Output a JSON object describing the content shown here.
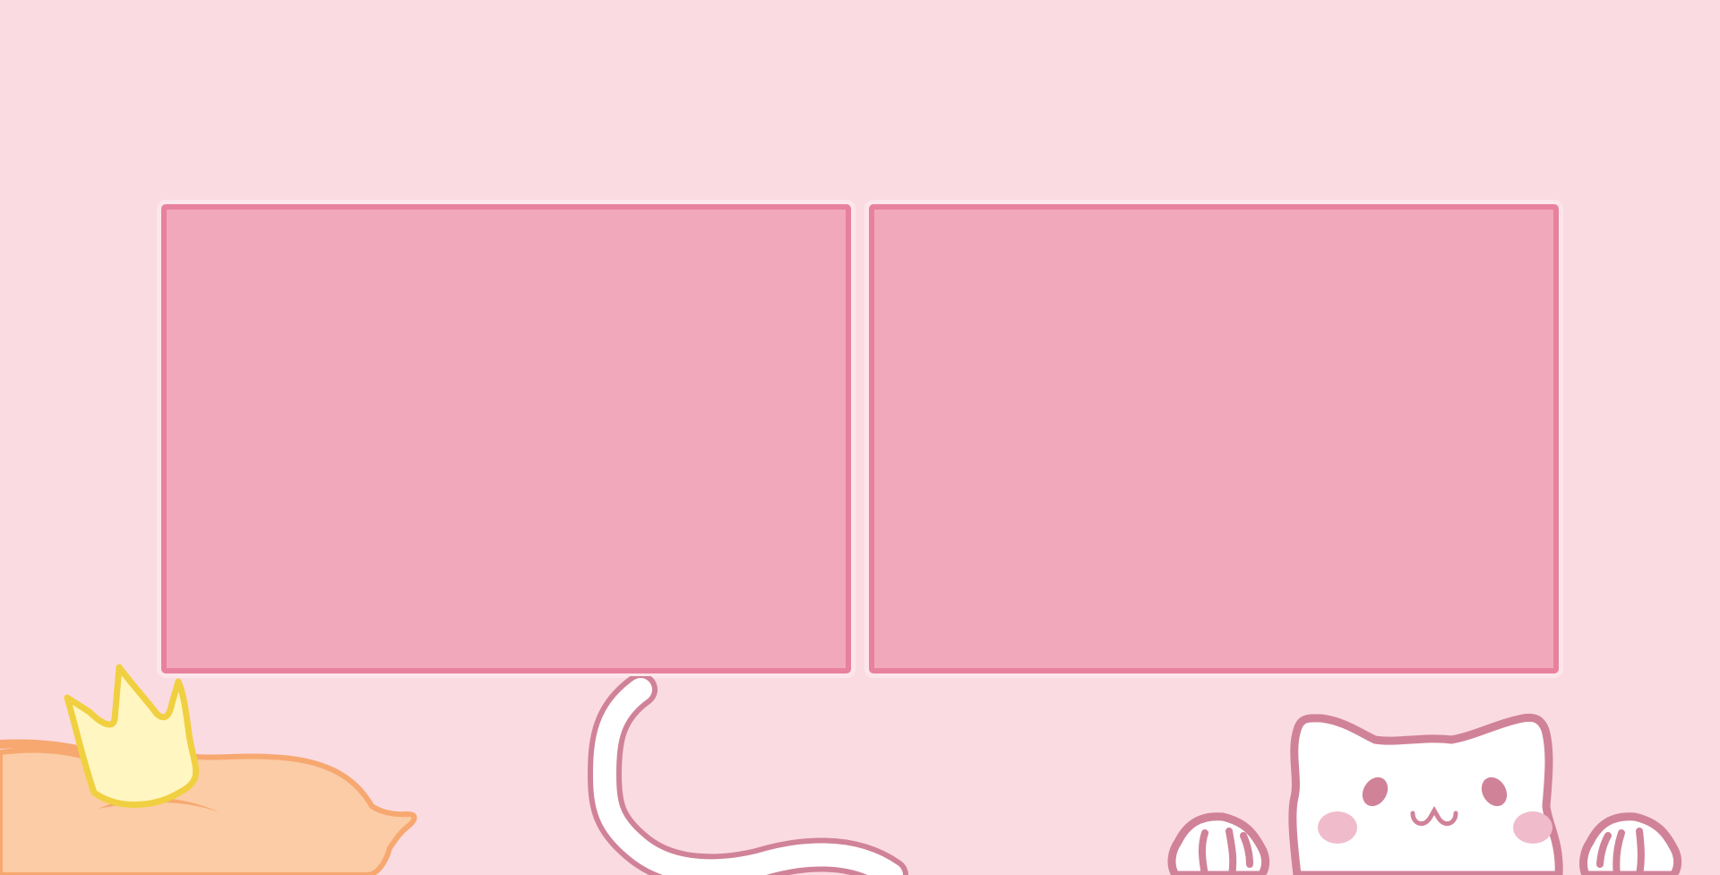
{
  "colors": {
    "background": "#fbdbe2",
    "panel_fill": "#f0a8ba",
    "panel_border": "#e8819d",
    "panel_outer_rim": "#fce6eb",
    "cat_outline": "#d08299",
    "cat_fill": "#ffffff",
    "cat_blush": "#f0bccb",
    "orange_cat_fill": "#fbcca6",
    "orange_cat_outline": "#f7a870",
    "crown_fill": "#fff6c2",
    "crown_outline": "#f0d040"
  },
  "panels": [
    {
      "id": "left"
    },
    {
      "id": "right"
    }
  ],
  "decorations": {
    "left_cat_icon": "sleeping-orange-cat-with-crown",
    "tail_icon": "white-cat-tail",
    "right_cat_icon": "peeking-white-cat"
  }
}
